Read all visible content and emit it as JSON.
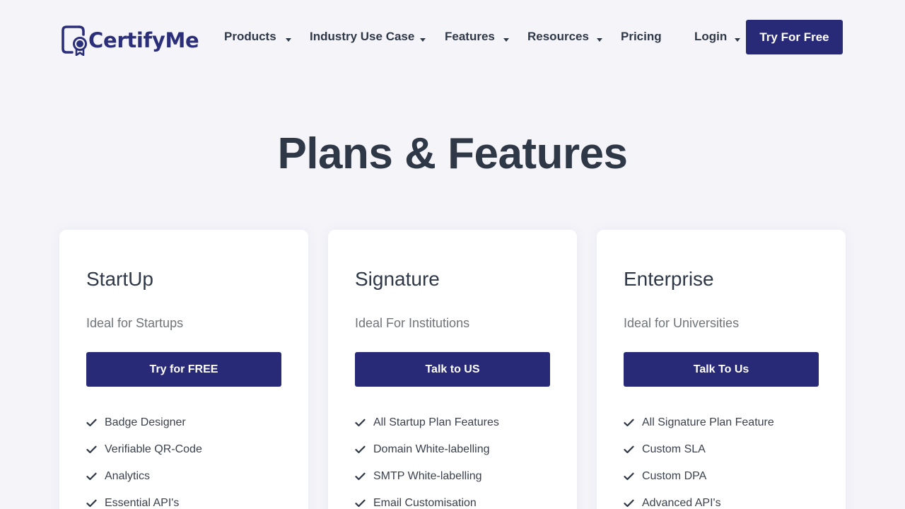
{
  "header": {
    "logo_text": "CertifyMe",
    "nav": [
      {
        "label": "Products",
        "has_dropdown": true
      },
      {
        "label": "Industry Use Case",
        "has_dropdown": true
      },
      {
        "label": "Features",
        "has_dropdown": true
      },
      {
        "label": "Resources",
        "has_dropdown": true
      },
      {
        "label": "Pricing",
        "has_dropdown": false
      },
      {
        "label": "Login",
        "has_dropdown": true
      }
    ],
    "cta_label": "Try For Free"
  },
  "main": {
    "title": "Plans & Features",
    "plans": [
      {
        "name": "StartUp",
        "subtitle": "Ideal for Startups",
        "button": "Try for FREE",
        "features": [
          "Badge Designer",
          "Verifiable QR-Code",
          "Analytics",
          "Essential API's"
        ]
      },
      {
        "name": "Signature",
        "subtitle": "Ideal For Institutions",
        "button": "Talk to US",
        "features": [
          "All Startup Plan Features",
          "Domain White-labelling",
          "SMTP White-labelling",
          "Email Customisation"
        ]
      },
      {
        "name": "Enterprise",
        "subtitle": "Ideal for Universities",
        "button": "Talk To Us",
        "features": [
          "All Signature Plan Feature",
          "Custom SLA",
          "Custom DPA",
          "Advanced API's"
        ]
      }
    ]
  },
  "icons": {
    "logo": "certificate-badge-icon",
    "dropdown": "caret-down-icon",
    "feature": "check-icon"
  },
  "colors": {
    "brand": "#282a78",
    "background": "#f4f4f9",
    "card": "#ffffff",
    "text": "#2f3847",
    "muted": "#6f7479"
  }
}
